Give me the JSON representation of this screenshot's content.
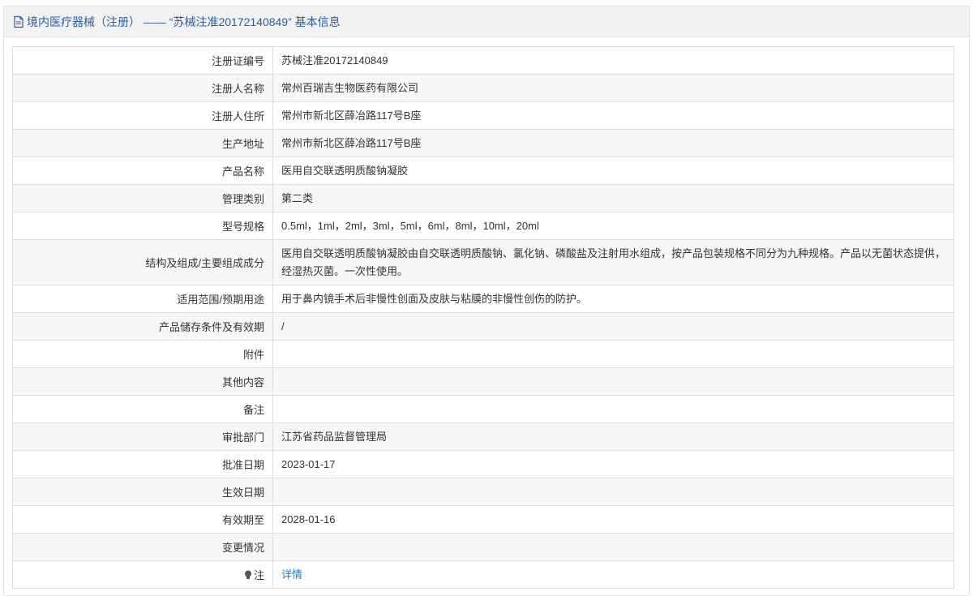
{
  "header": {
    "title": "境内医疗器械（注册） —— “苏械注准20172140849” 基本信息"
  },
  "rows": [
    {
      "label": "注册证编号",
      "value": "苏械注准20172140849"
    },
    {
      "label": "注册人名称",
      "value": "常州百瑞吉生物医药有限公司"
    },
    {
      "label": "注册人住所",
      "value": "常州市新北区薛冶路117号B座"
    },
    {
      "label": "生产地址",
      "value": "常州市新北区薛冶路117号B座"
    },
    {
      "label": "产品名称",
      "value": "医用自交联透明质酸钠凝胶"
    },
    {
      "label": "管理类别",
      "value": "第二类"
    },
    {
      "label": "型号规格",
      "value": "0.5ml，1ml，2ml，3ml，5ml，6ml，8ml，10ml，20ml"
    },
    {
      "label": "结构及组成/主要组成成分",
      "value": "医用自交联透明质酸钠凝胶由自交联透明质酸钠、氯化钠、磷酸盐及注射用水组成，按产品包装规格不同分为九种规格。产品以无菌状态提供，经湿热灭菌。一次性使用。"
    },
    {
      "label": "适用范围/预期用途",
      "value": "用于鼻内镜手术后非慢性创面及皮肤与粘膜的非慢性创伤的防护。"
    },
    {
      "label": "产品储存条件及有效期",
      "value": "/"
    },
    {
      "label": "附件",
      "value": ""
    },
    {
      "label": "其他内容",
      "value": ""
    },
    {
      "label": "备注",
      "value": ""
    },
    {
      "label": "审批部门",
      "value": "江苏省药品监督管理局"
    },
    {
      "label": "批准日期",
      "value": "2023-01-17"
    },
    {
      "label": "生效日期",
      "value": ""
    },
    {
      "label": "有效期至",
      "value": "2028-01-16"
    },
    {
      "label": "变更情况",
      "value": ""
    }
  ],
  "note": {
    "label": "注",
    "link_text": "详情",
    "icon": "lightbulb-icon"
  },
  "icons": {
    "header": "document-icon"
  },
  "colors": {
    "accent": "#2a5caa",
    "link": "#2a7ac2",
    "header_bg": "#f2f2f2",
    "stripe_bg": "#f7f7f7"
  }
}
